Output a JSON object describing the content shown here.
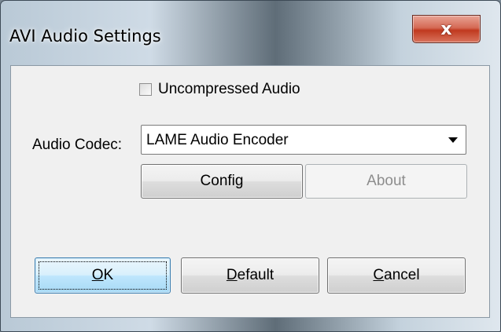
{
  "window": {
    "title": "AVI Audio Settings",
    "close_glyph": "x"
  },
  "form": {
    "uncompressed_label": "Uncompressed Audio",
    "uncompressed_checked": false,
    "codec_label": "Audio Codec:",
    "codec_value": "LAME Audio Encoder"
  },
  "buttons": {
    "config": "Config",
    "about": "About",
    "ok_mnemonic": "O",
    "ok_rest": "K",
    "default_mnemonic": "D",
    "default_rest": "efault",
    "cancel_mnemonic": "C",
    "cancel_rest": "ancel"
  },
  "icons": {
    "close": "close-icon",
    "dropdown": "chevron-down-icon"
  },
  "colors": {
    "close_button": "#c0391f",
    "default_button": "#bee6fd",
    "dialog_face": "#f0f0f0"
  }
}
